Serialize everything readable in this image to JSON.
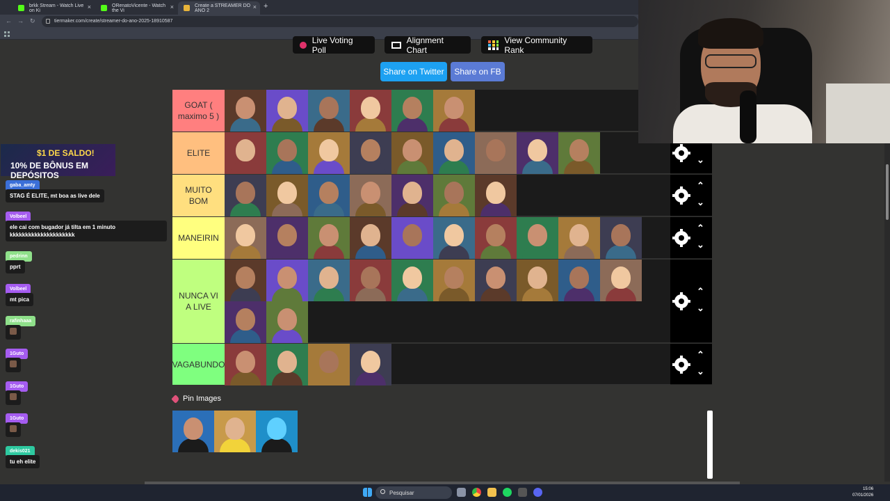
{
  "browser": {
    "tabs": [
      {
        "label": "brkk Stream - Watch Live on Ki",
        "color": "#53fc18"
      },
      {
        "label": "ORenatoVicente - Watch the Vi",
        "color": "#53fc18"
      },
      {
        "label": "Create a STREAMER DO ANO 2",
        "color": "#e8b43a"
      }
    ],
    "url": "tiermaker.com/create/streamer-do-ano-2025-18910587"
  },
  "toolbar": {
    "live_voting": "Live Voting Poll",
    "alignment": "Alignment Chart",
    "community_rank": "View Community Rank",
    "share_twitter": "Share on Twitter",
    "share_fb": "Share on FB"
  },
  "tiers": [
    {
      "label": "GOAT ( maximo 5 )",
      "color": "#ff7f7f",
      "count": 6
    },
    {
      "label": "ELITE",
      "color": "#ffbf7f",
      "count": 9
    },
    {
      "label": "MUITO BOM",
      "color": "#ffdf7f",
      "count": 7
    },
    {
      "label": "MANEIRIN",
      "color": "#ffff7f",
      "count": 10
    },
    {
      "label": "NUNCA VI A LIVE",
      "color": "#bfff7f",
      "count": 12
    },
    {
      "label": "VAGABUNDO",
      "color": "#7fff7f",
      "count": 4
    }
  ],
  "pin": {
    "title": "Pin Images",
    "count": 3
  },
  "chat": {
    "ad_line1": "$1 DE SALDO!",
    "ad_line2": "10% DE BÔNUS EM DEPÓSITOS",
    "messages": [
      {
        "user": "gaba_amty",
        "text": "STAG É ELITE, mt boa as live dele",
        "color": "#3b6fd8"
      },
      {
        "user": "Volbeel",
        "text": "ele cai com bugador já tilta em 1 minuto",
        "text2": "kkkkkkkkkkkkkkkkkkkkk",
        "color": "#a55cf0"
      },
      {
        "user": "pedrinn",
        "text": "pprt",
        "color": "#8fe08a"
      },
      {
        "user": "Volbeel",
        "text": "mt pica",
        "color": "#a55cf0"
      },
      {
        "user": "rafinhaaa",
        "text": "",
        "color": "#8fe08a"
      },
      {
        "user": "1Guto",
        "text": "",
        "color": "#a55cf0"
      },
      {
        "user": "1Guto",
        "text": "",
        "color": "#a55cf0"
      },
      {
        "user": "1Guto",
        "text": "",
        "color": "#a55cf0"
      },
      {
        "user": "dekis021",
        "text": "tu eh elite",
        "color": "#2ec9a0"
      }
    ]
  },
  "taskbar": {
    "search": "Pesquisar",
    "time": "15:06",
    "date": "07/01/2026"
  }
}
